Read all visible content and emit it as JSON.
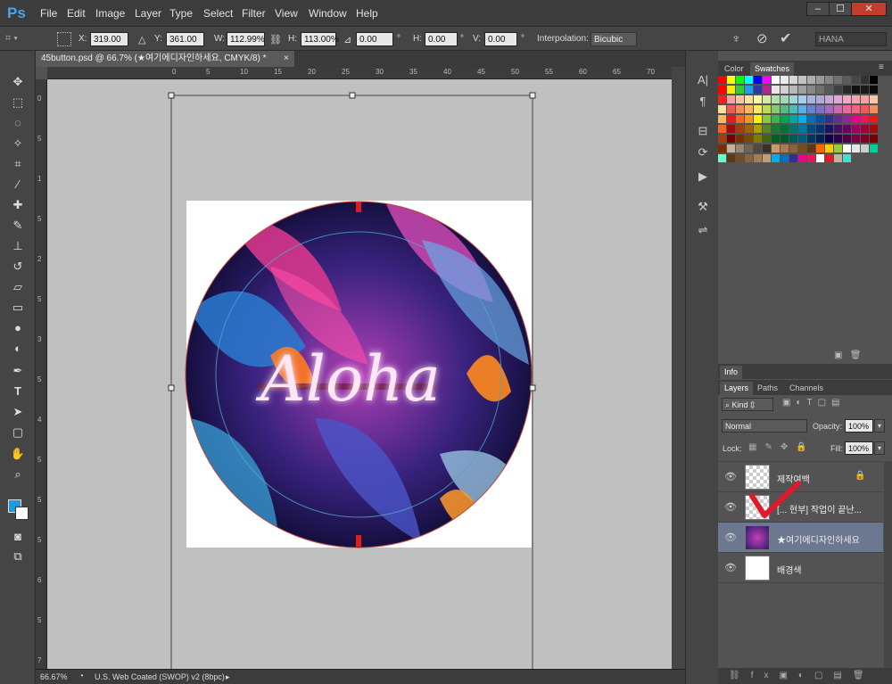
{
  "app": {
    "logo": "Ps"
  },
  "menu": [
    "File",
    "Edit",
    "Image",
    "Layer",
    "Type",
    "Select",
    "Filter",
    "View",
    "Window",
    "Help"
  ],
  "window_buttons": [
    "–",
    "☐",
    "✕"
  ],
  "options": {
    "x_label": "X:",
    "x_value": "319.00 px",
    "y_label": "Y:",
    "y_value": "361.00 px",
    "w_label": "W:",
    "w_value": "112.99%",
    "h_label": "H:",
    "h_value": "113.00%",
    "angle_value": "0.00",
    "angle_unit": "°",
    "hskew_label": "H:",
    "hskew_value": "0.00",
    "hskew_unit": "°",
    "vskew_label": "V:",
    "vskew_value": "0.00",
    "vskew_unit": "°",
    "interp_label": "Interpolation:",
    "interp_value": "Bicubic",
    "workspace": "HANA"
  },
  "document": {
    "tab_title": "45button.psd @ 66.7% (★여기에디자인하세요, CMYK/8) *",
    "tab_close": "×",
    "artwork_text": "Aloha"
  },
  "rulers": {
    "h": [
      "0",
      "5",
      "10",
      "15",
      "20",
      "25",
      "30",
      "35",
      "40",
      "45",
      "50",
      "55",
      "60",
      "65",
      "70",
      "75"
    ],
    "v": [
      "0",
      "5",
      "1",
      "5",
      "2",
      "5",
      "3",
      "5",
      "4",
      "5",
      "5",
      "5",
      "6",
      "5",
      "7"
    ]
  },
  "status": {
    "zoom": "66.67%",
    "profile": "U.S. Web Coated (SWOP) v2 (8bpc)"
  },
  "panels": {
    "top_tabs": [
      "Color",
      "Swatches"
    ],
    "info_tab": "Info",
    "layer_tabs": [
      "Layers",
      "Paths",
      "Channels"
    ],
    "kind": "Kind",
    "blend_mode": "Normal",
    "opacity_label": "Opacity:",
    "opacity_value": "100%",
    "lock_label": "Lock:",
    "fill_label": "Fill:",
    "fill_value": "100%"
  },
  "layers": [
    {
      "name": "제작여백",
      "locked": true
    },
    {
      "name": "[... 현부] 작업이 끝난...",
      "locked": false
    },
    {
      "name": "★여기에디자인하세요",
      "locked": false,
      "selected": true
    },
    {
      "name": "배경색",
      "locked": false
    }
  ],
  "swatch_colors": [
    "#ff0000",
    "#ffff00",
    "#00ff00",
    "#00ffff",
    "#0000ff",
    "#ff00ff",
    "#ffffff",
    "#ebebeb",
    "#d6d6d6",
    "#c2c2c2",
    "#adadad",
    "#999999",
    "#858585",
    "#707070",
    "#5c5c5c",
    "#474747",
    "#333333",
    "#000000",
    "#ff0000",
    "#f7ec0f",
    "#33cc33",
    "#1fa1e0",
    "#2b3a9e",
    "#b0288c",
    "#e8e8e8",
    "#d0d0d0",
    "#b8b8b8",
    "#a0a0a0",
    "#888888",
    "#707070",
    "#585858",
    "#404040",
    "#282828",
    "#101010",
    "#1a1a1a",
    "#0a0a0a",
    "#ff1a1a",
    "#f4a2a2",
    "#fbc4a0",
    "#fde0a0",
    "#fef7a0",
    "#d9eaa0",
    "#b7dfa8",
    "#a0d8b8",
    "#9fd9d6",
    "#a2cdef",
    "#a8b4e0",
    "#b0a8dc",
    "#c8a8d8",
    "#e0a8d0",
    "#f0a8c4",
    "#f4a4b0",
    "#f4a2a2",
    "#fbc4a0",
    "#fde0a0",
    "#ef5b5b",
    "#f68d5a",
    "#f9b85a",
    "#fce95a",
    "#bcd95a",
    "#8cc870",
    "#5ab887",
    "#4cbcb8",
    "#5aaee4",
    "#6a82cc",
    "#8070c0",
    "#a46cbc",
    "#cc6cb0",
    "#e86aa0",
    "#ee6680",
    "#ef5b5b",
    "#f68d5a",
    "#f9b85a",
    "#e6191c",
    "#f26522",
    "#f7941d",
    "#fff200",
    "#8dc63f",
    "#39b54a",
    "#00a651",
    "#00a99d",
    "#00aeef",
    "#0072bc",
    "#0054a6",
    "#2e3192",
    "#662d91",
    "#92278f",
    "#ec008c",
    "#ed145b",
    "#e6191c",
    "#f26522",
    "#9e0b0f",
    "#a0410d",
    "#a36209",
    "#aba000",
    "#598527",
    "#197b30",
    "#007236",
    "#00746b",
    "#0076a3",
    "#004a80",
    "#003471",
    "#1b1464",
    "#440e62",
    "#630460",
    "#9e005d",
    "#9e0039",
    "#9e0b0f",
    "#a0410d",
    "#790000",
    "#7b2e00",
    "#7d4900",
    "#827b00",
    "#406618",
    "#005e20",
    "#005826",
    "#005952",
    "#005b7f",
    "#003663",
    "#002157",
    "#0d004c",
    "#32004b",
    "#4b0049",
    "#7b0046",
    "#7a0026",
    "#790000",
    "#7b2e00",
    "#c7b299",
    "#998675",
    "#736357",
    "#534741",
    "#37302d",
    "#c69c6d",
    "#a67c52",
    "#8c6239",
    "#754c24",
    "#603913",
    "#ff6600",
    "#ffcc00",
    "#99cc33",
    "#ffffff",
    "#e6e6e6",
    "#cccccc",
    "#00cc99",
    "#66ffcc",
    "#603913",
    "#754c24",
    "#8c6239",
    "#a67c52",
    "#c69c6d",
    "#00aeef",
    "#0072bc",
    "#2e3192",
    "#ec008c",
    "#ed145b",
    "#ffffff",
    "#e6191c",
    "#c7b299",
    "#40e0d0"
  ],
  "tools": [
    "move-tool",
    "marquee-tool",
    "lasso-tool",
    "magic-wand-tool",
    "crop-tool",
    "eyedropper-tool",
    "healing-tool",
    "brush-tool",
    "stamp-tool",
    "history-brush-tool",
    "eraser-tool",
    "gradient-tool",
    "blur-tool",
    "dodge-tool",
    "pen-tool",
    "type-tool",
    "path-select-tool",
    "shape-tool",
    "hand-tool",
    "zoom-tool"
  ]
}
